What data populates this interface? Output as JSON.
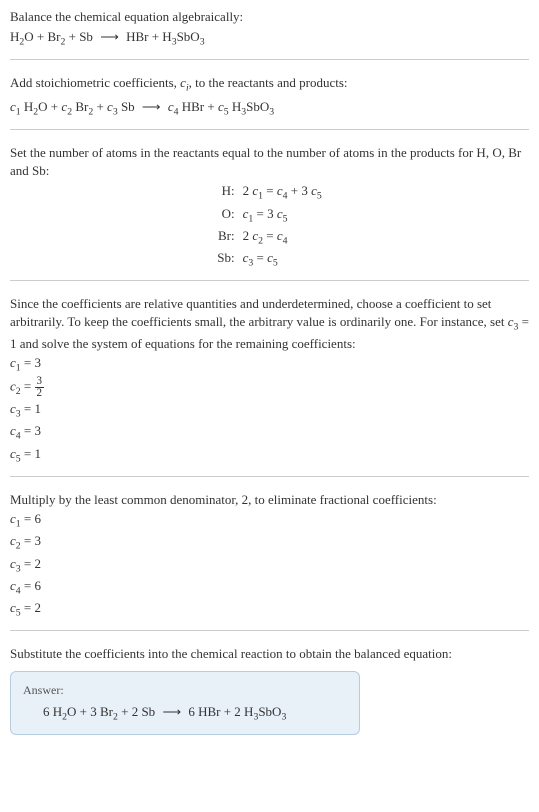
{
  "step1": {
    "intro": "Balance the chemical equation algebraically:",
    "equation": "H₂O + Br₂ + Sb ⟶ HBr + H3SbO3"
  },
  "step2": {
    "intro": "Add stoichiometric coefficients, cᵢ, to the reactants and products:",
    "equation": "c₁ H₂O + c₂ Br₂ + c₃ Sb ⟶ c₄ HBr + c₅ H3SbO3"
  },
  "step3": {
    "intro": "Set the number of atoms in the reactants equal to the number of atoms in the products for H, O, Br and Sb:",
    "rows": [
      {
        "label": "H:",
        "eq": "2 c₁ = c₄ + 3 c₅"
      },
      {
        "label": "O:",
        "eq": "c₁ = 3 c₅"
      },
      {
        "label": "Br:",
        "eq": "2 c₂ = c₄"
      },
      {
        "label": "Sb:",
        "eq": "c₃ = c₅"
      }
    ]
  },
  "step4": {
    "intro": "Since the coefficients are relative quantities and underdetermined, choose a coefficient to set arbitrarily. To keep the coefficients small, the arbitrary value is ordinarily one. For instance, set c₃ = 1 and solve the system of equations for the remaining coefficients:",
    "coeffs": {
      "c1": "c₁ = 3",
      "c2_lhs": "c₂ = ",
      "c2_num": "3",
      "c2_den": "2",
      "c3": "c₃ = 1",
      "c4": "c₄ = 3",
      "c5": "c₅ = 1"
    }
  },
  "step5": {
    "intro": "Multiply by the least common denominator, 2, to eliminate fractional coefficients:",
    "coeffs": [
      "c₁ = 6",
      "c₂ = 3",
      "c₃ = 2",
      "c₄ = 6",
      "c₅ = 2"
    ]
  },
  "step6": {
    "intro": "Substitute the coefficients into the chemical reaction to obtain the balanced equation:"
  },
  "answer": {
    "label": "Answer:",
    "equation": "6 H₂O + 3 Br₂ + 2 Sb ⟶ 6 HBr + 2 H3SbO3"
  }
}
